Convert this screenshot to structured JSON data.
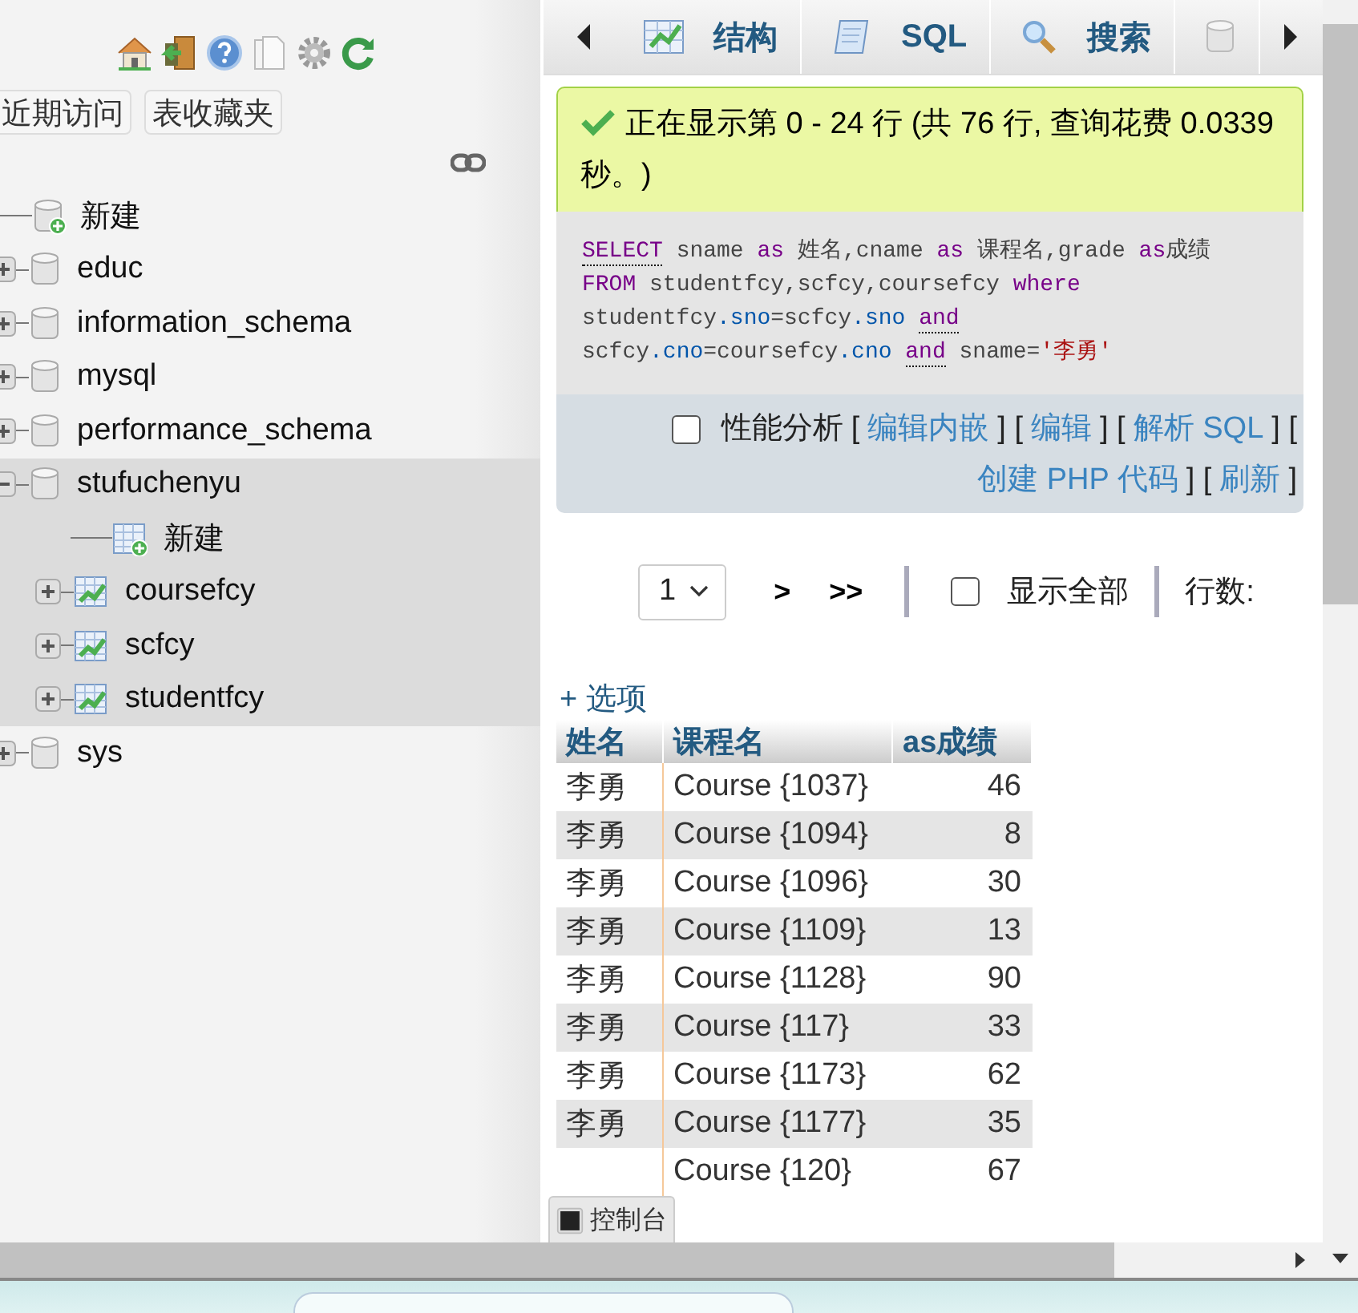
{
  "nav_buttons": [
    {
      "label": "近期访问"
    },
    {
      "label": "表收藏夹"
    }
  ],
  "tree": [
    {
      "label": "新建",
      "kind": "new"
    },
    {
      "label": "educ",
      "kind": "database",
      "expanded": false
    },
    {
      "label": "information_schema",
      "kind": "database",
      "expanded": false
    },
    {
      "label": "mysql",
      "kind": "database",
      "expanded": false
    },
    {
      "label": "performance_schema",
      "kind": "database",
      "expanded": false
    },
    {
      "label": "stufuchenyu",
      "kind": "database",
      "expanded": true,
      "selected": true,
      "children": [
        {
          "label": "新建",
          "kind": "new-table"
        },
        {
          "label": "coursefcy",
          "kind": "table",
          "expanded": false
        },
        {
          "label": "scfcy",
          "kind": "table",
          "expanded": false
        },
        {
          "label": "studentfcy",
          "kind": "table",
          "expanded": false
        }
      ]
    },
    {
      "label": "sys",
      "kind": "database",
      "expanded": false,
      "selected": false
    }
  ],
  "tabs": [
    {
      "label": "结构",
      "kind": "structure",
      "selected": false
    },
    {
      "label": "SQL",
      "kind": "sql",
      "selected": false
    },
    {
      "label": "搜索",
      "kind": "search",
      "selected": false
    },
    {
      "kind": "database",
      "selected": false
    }
  ],
  "message": "正在显示第 0 - 24 行 (共 76 行, 查询花费 0.0339 秒。)",
  "sql": [
    {
      "kind": "keyword-link",
      "text": "SELECT"
    },
    {
      "kind": "plain",
      "text": " sname "
    },
    {
      "kind": "keyword",
      "text": "as"
    },
    {
      "kind": "plain",
      "text": " 姓名,cname "
    },
    {
      "kind": "keyword",
      "text": "as"
    },
    {
      "kind": "plain",
      "text": " 课程名,grade "
    },
    {
      "kind": "keyword",
      "text": "as"
    },
    {
      "kind": "plain",
      "text": "成绩 "
    },
    {
      "kind": "keyword",
      "text": "FROM"
    },
    {
      "kind": "plain",
      "text": " studentfcy,scfcy,coursefcy "
    },
    {
      "kind": "keyword",
      "text": "where"
    },
    {
      "kind": "plain",
      "text": " studentfcy"
    },
    {
      "kind": "field",
      "text": ".sno"
    },
    {
      "kind": "plain",
      "text": "=scfcy"
    },
    {
      "kind": "field",
      "text": ".sno "
    },
    {
      "kind": "keyword-link",
      "text": "and"
    },
    {
      "kind": "plain",
      "text": " scfcy"
    },
    {
      "kind": "field",
      "text": ".cno"
    },
    {
      "kind": "plain",
      "text": "=coursefcy"
    },
    {
      "kind": "field",
      "text": ".cno "
    },
    {
      "kind": "keyword-link",
      "text": "and"
    },
    {
      "kind": "plain",
      "text": " sname="
    },
    {
      "kind": "string",
      "text": "'李勇'"
    }
  ],
  "profiling": {
    "label": "性能分析",
    "checked": false
  },
  "actions": [
    {
      "kind": "text",
      "text": "["
    },
    {
      "kind": "link",
      "text": "编辑内嵌"
    },
    {
      "kind": "text",
      "text": "] ["
    },
    {
      "kind": "link",
      "text": "编辑"
    },
    {
      "kind": "text",
      "text": "] ["
    },
    {
      "kind": "link",
      "text": "解析 SQL"
    },
    {
      "kind": "text",
      "text": "] ["
    },
    {
      "kind": "link",
      "text": "创建 PHP 代码"
    },
    {
      "kind": "text",
      "text": "] ["
    },
    {
      "kind": "link",
      "text": "刷新"
    },
    {
      "kind": "text",
      "text": "]"
    }
  ],
  "pager": {
    "page": "1",
    "next": ">",
    "last": ">>",
    "show_all": {
      "label": "显示全部",
      "checked": false
    },
    "rows_label": "行数:"
  },
  "options_link": "+ 选项",
  "table": {
    "columns": [
      "姓名",
      "课程名",
      "as成绩"
    ],
    "rows": [
      {
        "name": "李勇",
        "course": "Course {1037}",
        "grade": "46"
      },
      {
        "name": "李勇",
        "course": "Course {1094}",
        "grade": "8"
      },
      {
        "name": "李勇",
        "course": "Course {1096}",
        "grade": "30"
      },
      {
        "name": "李勇",
        "course": "Course {1109}",
        "grade": "13"
      },
      {
        "name": "李勇",
        "course": "Course {1128}",
        "grade": "90"
      },
      {
        "name": "李勇",
        "course": "Course {117}",
        "grade": "33"
      },
      {
        "name": "李勇",
        "course": "Course {1173}",
        "grade": "62"
      },
      {
        "name": "李勇",
        "course": "Course {1177}",
        "grade": "35"
      },
      {
        "course": "Course {120}",
        "grade": "67"
      }
    ]
  },
  "console": {
    "label": "控制台"
  }
}
